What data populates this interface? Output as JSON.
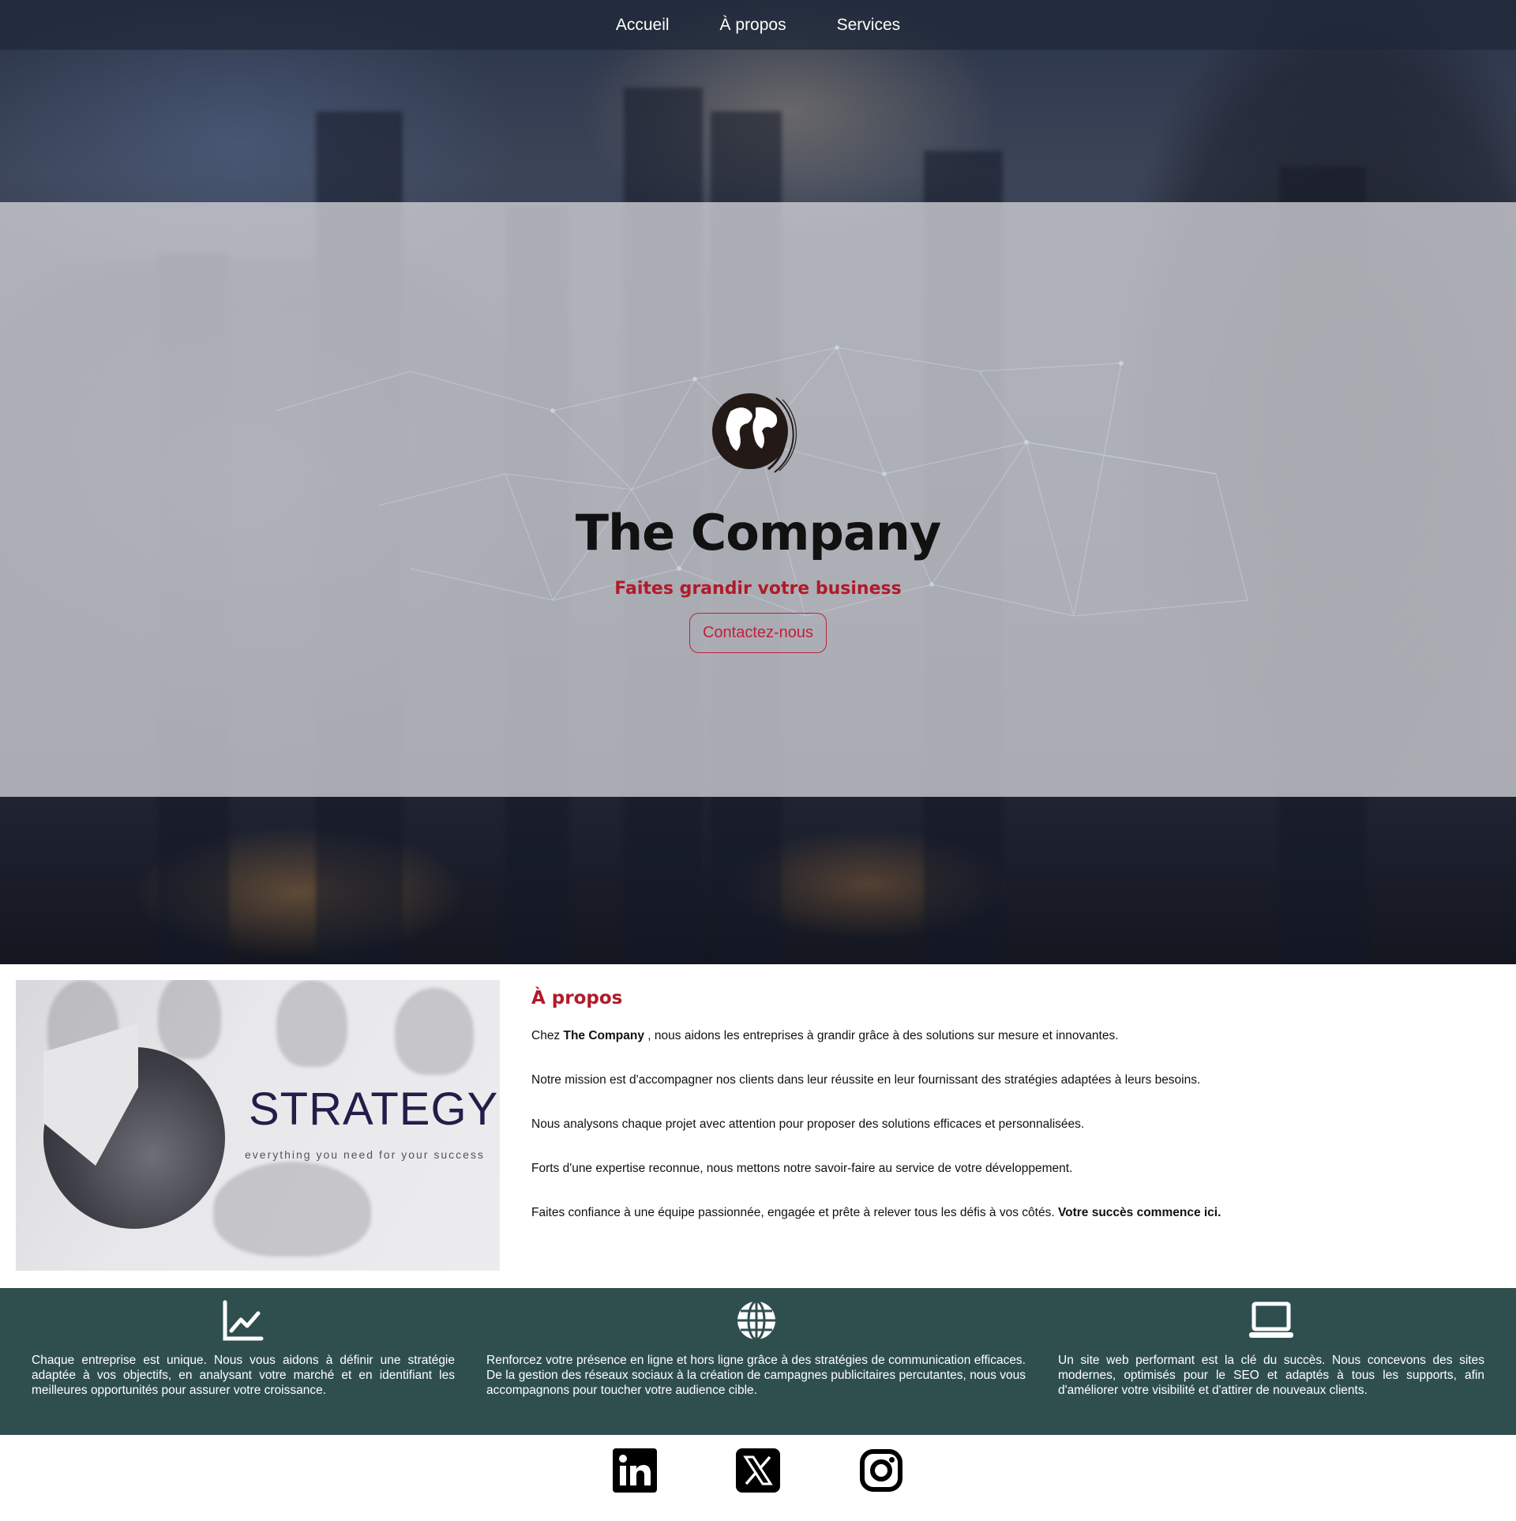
{
  "nav": {
    "items": [
      {
        "label": "Accueil"
      },
      {
        "label": "À propos"
      },
      {
        "label": "Services"
      }
    ]
  },
  "hero": {
    "brand": "The Company",
    "tagline": "Faites grandir votre business",
    "cta_label": "Contactez-nous",
    "logo_icon": "globe-logo-icon"
  },
  "about": {
    "title": "À propos",
    "image": {
      "heading": "STRATEGY",
      "subheading": "everything you need for your success"
    },
    "p1_prefix": "Chez ",
    "p1_bold": "The Company",
    "p1_suffix": " , nous aidons les entreprises à grandir grâce à des solutions sur mesure et innovantes.",
    "p2": "Notre mission est d'accompagner nos clients dans leur réussite en leur fournissant des stratégies adaptées à leurs besoins.",
    "p3": "Nous analysons chaque projet avec attention pour proposer des solutions efficaces et personnalisées.",
    "p4": "Forts d'une expertise reconnue, nous mettons notre savoir-faire au service de votre développement.",
    "p5_text": "Faites confiance à une équipe passionnée, engagée et prête à relever tous les défis à vos côtés. ",
    "p5_bold": "Votre succès commence ici."
  },
  "services": [
    {
      "icon": "chart-line-icon",
      "text": "Chaque entreprise est unique. Nous vous aidons à définir une stratégie adaptée à vos objectifs, en analysant votre marché et en identifiant les meilleures opportunités pour assurer votre croissance."
    },
    {
      "icon": "globe-icon",
      "text": "Renforcez votre présence en ligne et hors ligne grâce à des stratégies de communication efficaces. De la gestion des réseaux sociaux à la création de campagnes publicitaires percutantes, nous vous accompagnons pour toucher votre audience cible."
    },
    {
      "icon": "laptop-icon",
      "text": "Un site web performant est la clé du succès. Nous concevons des sites modernes, optimisés pour le SEO et adaptés à tous les supports, afin d'améliorer votre visibilité et d'attirer de nouveaux clients."
    }
  ],
  "social": [
    {
      "icon": "linkedin-icon"
    },
    {
      "icon": "x-twitter-icon"
    },
    {
      "icon": "instagram-icon"
    }
  ],
  "colors": {
    "accent_red": "#b11a2a",
    "services_bg": "#2f4f4f",
    "nav_bg": "#1e2837"
  }
}
